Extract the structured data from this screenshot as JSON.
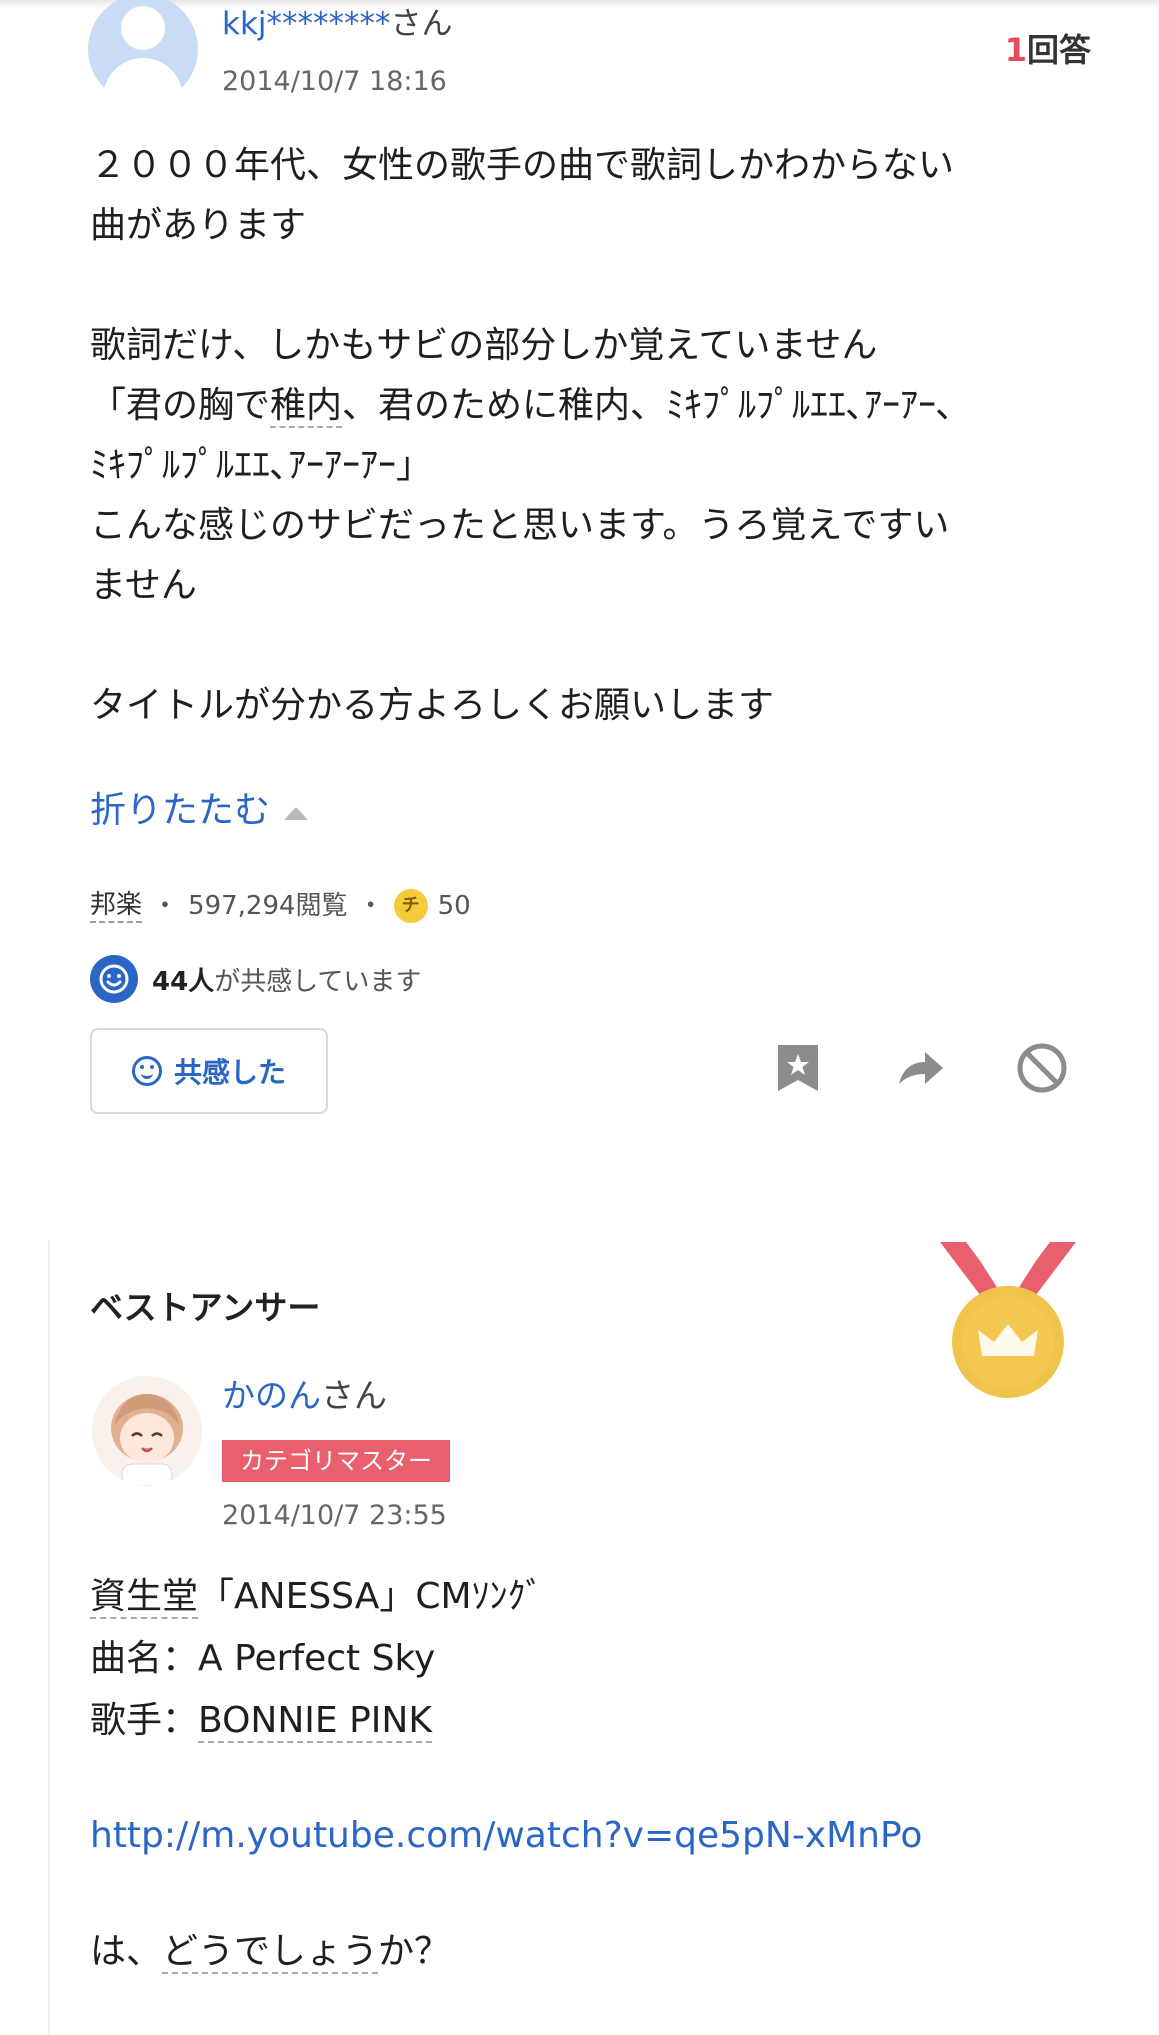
{
  "question": {
    "user_name": "kkj********",
    "user_suffix": "さん",
    "date": "2014/10/7 18:16",
    "answer_count": "1",
    "answer_count_label": "回答",
    "body": {
      "l1": "２０００年代、女性の歌手の曲で歌詞しかわからない",
      "l2": "曲があります",
      "l3": "歌詞だけ、しかもサビの部分しか覚えていません",
      "l4a": "「君の胸で",
      "l4b": "稚内",
      "l4c": "、君のために稚内、ﾐｷﾌﾟﾙﾌﾟﾙｴｴ､ｱｰｱｰ､",
      "l5": "ﾐｷﾌﾟﾙﾌﾟﾙｴｴ､ｱｰｱｰｱｰ」",
      "l6": "こんな感じのサビだったと思います。うろ覚えですい",
      "l7": "ません",
      "l8": "タイトルが分かる方よろしくお願いします"
    },
    "fold_label": "折りたたむ",
    "category": "邦楽",
    "views": "597,294閲覧",
    "coin_symbol": "チ",
    "coins": "50",
    "empathy_count": "44人",
    "empathy_text": "が共感しています",
    "empathy_button": "共感した"
  },
  "icons": {
    "bookmark": "bookmark-icon",
    "share": "share-icon",
    "block": "block-icon",
    "medal": "gold-medal-icon"
  },
  "best_answer": {
    "title": "ベストアンサー",
    "user_name": "かのん",
    "user_suffix": "さん",
    "badge": "カテゴリマスター",
    "date": "2014/10/7 23:55",
    "l1a": "資生堂",
    "l1b": "「ANESSA」CMｿﾝｸﾞ",
    "l2": "曲名：A Perfect Sky",
    "l3a": "歌手：",
    "l3b": "BONNIE PINK",
    "link": "http://m.youtube.com/watch?v=qe5pN-xMnPo",
    "l5a": "は、",
    "l5b": "どうでしょう",
    "l5c": "か？"
  },
  "colors": {
    "link": "#2a66c6",
    "answer_count": "#e84a5f",
    "badge": "#e8606e",
    "medal_gold": "#f0c34a",
    "ribbon": "#e8606e"
  }
}
